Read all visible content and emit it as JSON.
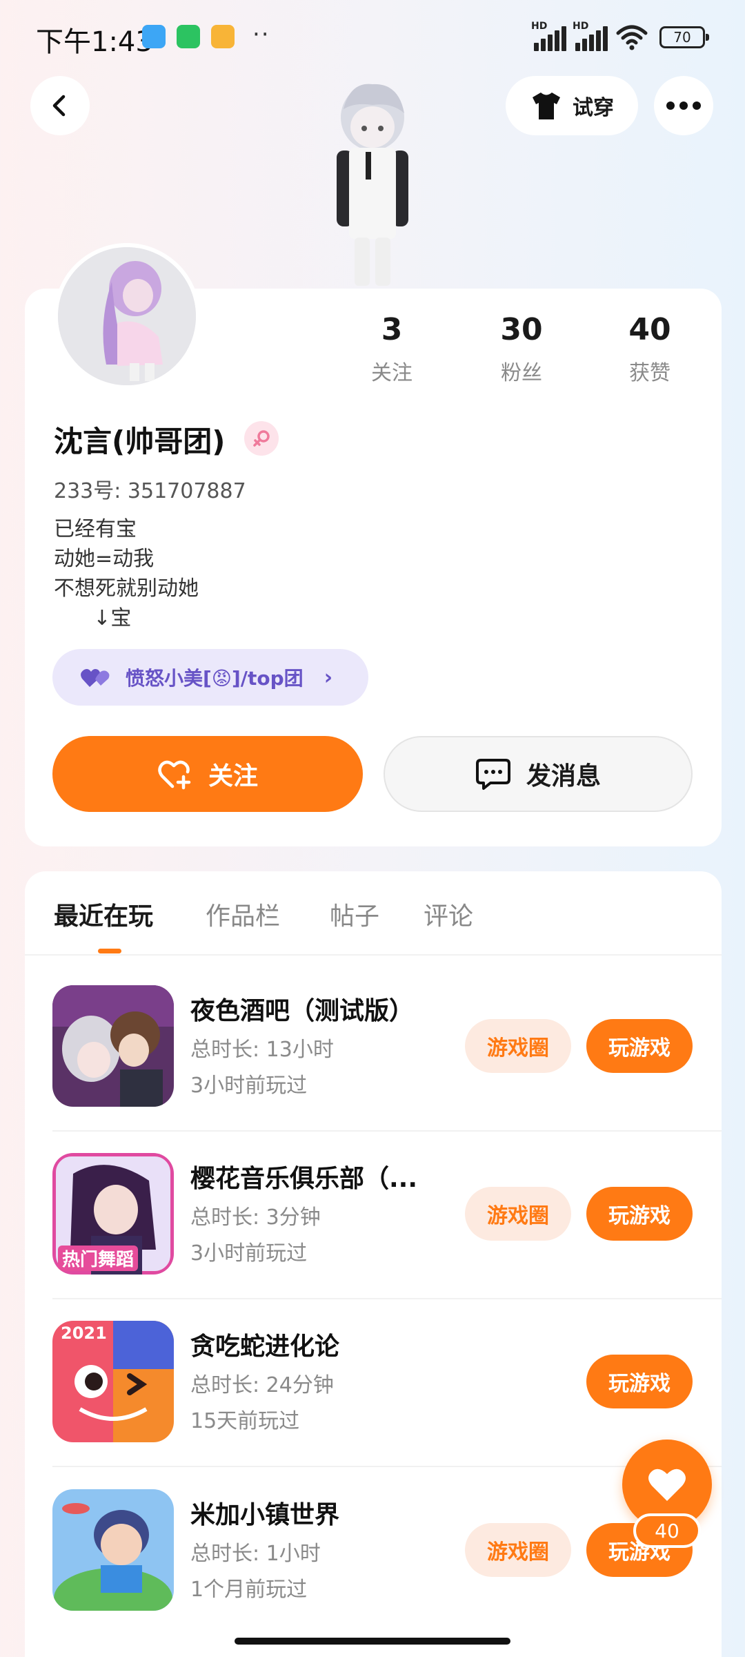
{
  "status_bar": {
    "time": "下午1:43",
    "dots": "··",
    "hd_label": "HD",
    "battery": "70",
    "app_icons": [
      "messenger-blue-icon",
      "wechat-icon",
      "notes-orange-icon"
    ]
  },
  "header": {
    "back_icon": "back-arrow-icon",
    "tryon_label": "试穿",
    "more_icon": "more-dots-icon"
  },
  "profile": {
    "stats": [
      {
        "value": "3",
        "label": "关注"
      },
      {
        "value": "30",
        "label": "粉丝"
      },
      {
        "value": "40",
        "label": "获赞"
      }
    ],
    "username": "沈言(帅哥团)",
    "gender_icon": "female-symbol-icon",
    "user_id": "233号: 351707887",
    "bio_lines": [
      "已经有宝",
      "动她=动我",
      "不想死就别动她",
      "      ↓宝"
    ],
    "group_label": "愤怒小美[😡]/top团",
    "follow_label": "关注",
    "message_label": "发消息"
  },
  "tabs": [
    {
      "label": "最近在玩",
      "active": true
    },
    {
      "label": "作品栏",
      "active": false
    },
    {
      "label": "帖子",
      "active": false
    },
    {
      "label": "评论",
      "active": false
    }
  ],
  "games": [
    {
      "title": "夜色酒吧（测试版）",
      "duration": "总时长: 13小时",
      "played": "3小时前玩过",
      "circle_label": "游戏圈",
      "play_label": "玩游戏"
    },
    {
      "title": "樱花音乐俱乐部（...",
      "duration": "总时长: 3分钟",
      "played": "3小时前玩过",
      "circle_label": "游戏圈",
      "play_label": "玩游戏",
      "icon_text": "热门舞蹈"
    },
    {
      "title": "贪吃蛇进化论",
      "duration": "总时长: 24分钟",
      "played": "15天前玩过",
      "play_label": "玩游戏",
      "icon_text": "2021"
    },
    {
      "title": "米加小镇世界",
      "duration": "总时长: 1小时",
      "played": "1个月前玩过",
      "circle_label": "游戏圈",
      "play_label": "玩游戏"
    }
  ],
  "fab": {
    "count": "40",
    "icon": "heart-icon"
  },
  "colors": {
    "accent": "#ff7a14",
    "accent_light": "#fdeae0",
    "group_bg": "#ebe8fb",
    "group_text": "#6753c6"
  }
}
